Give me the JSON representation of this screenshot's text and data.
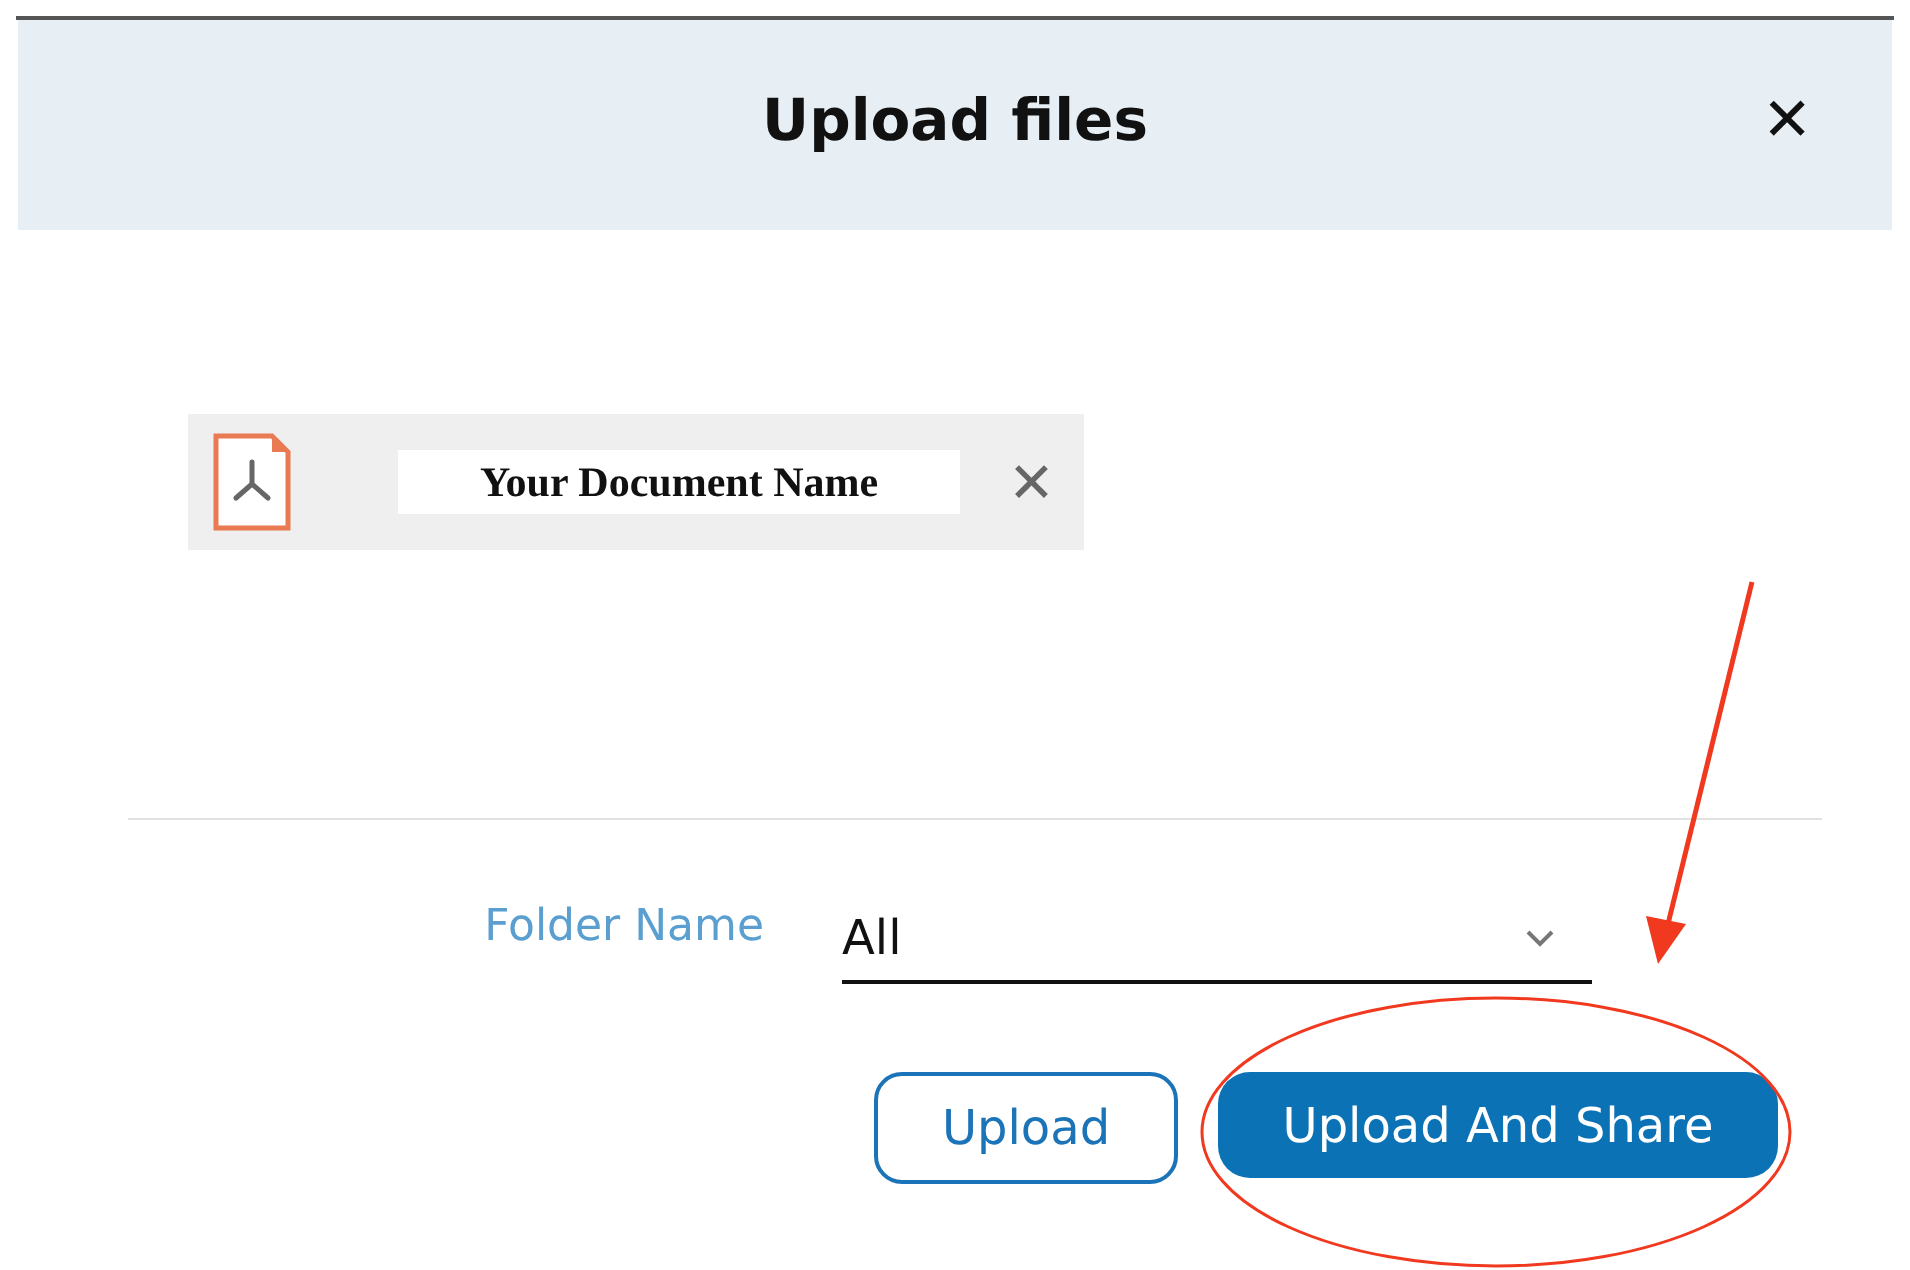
{
  "dialog": {
    "title": "Upload files",
    "close_label": "✕"
  },
  "files": [
    {
      "name": "Your Document Name",
      "kind": "pdf",
      "remove_label": "✕"
    }
  ],
  "folder": {
    "label": "Folder Name",
    "value": "All"
  },
  "buttons": [
    {
      "label": "Upload",
      "kind": "outline"
    },
    {
      "label": "Upload And Share",
      "kind": "primary"
    }
  ]
}
